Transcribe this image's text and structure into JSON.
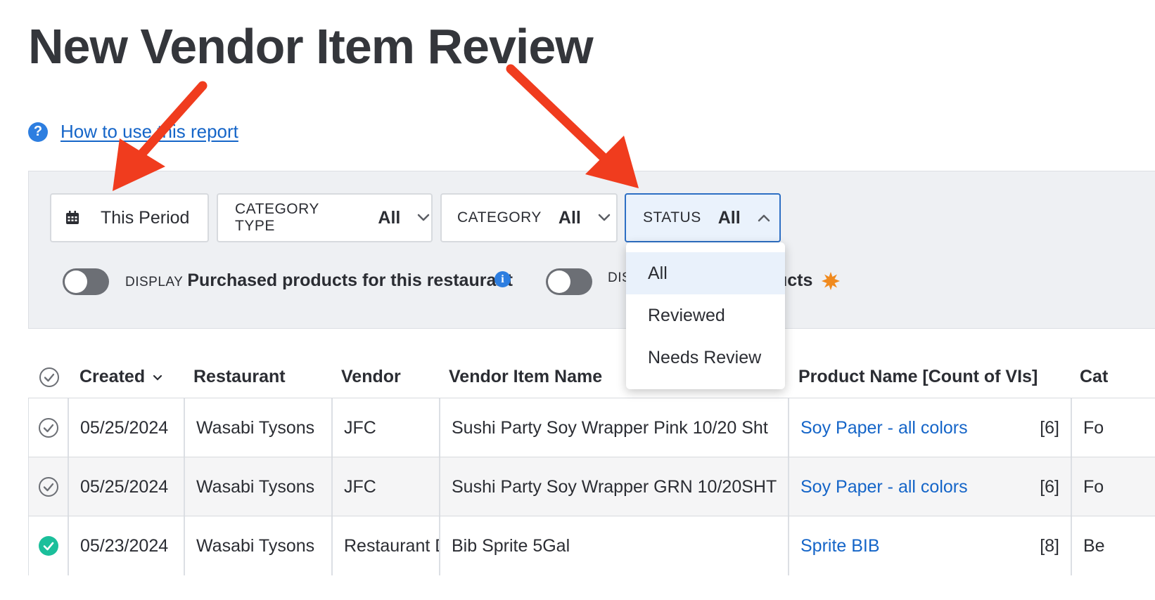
{
  "page": {
    "title": "New Vendor Item Review",
    "help_link": "How to use this report"
  },
  "filters": {
    "period": "This Period",
    "category_type": {
      "label": "CATEGORY TYPE",
      "value": "All"
    },
    "category": {
      "label": "CATEGORY",
      "value": "All"
    },
    "status": {
      "label": "STATUS",
      "value": "All"
    }
  },
  "status_dropdown": {
    "options": [
      "All",
      "Reviewed",
      "Needs Review"
    ],
    "selected": "All"
  },
  "toggles": [
    {
      "small": "DISPLAY",
      "bold": "Purchased products for this restaurant",
      "on": false
    },
    {
      "small": "DIS",
      "bold": "ucts",
      "on": false
    }
  ],
  "table": {
    "headers": [
      "Created",
      "Restaurant",
      "Vendor",
      "Vendor Item Name",
      "Product Name [Count of VIs]",
      "Cat"
    ],
    "rows": [
      {
        "created": "05/25/2024",
        "restaurant": "Wasabi Tysons",
        "vendor": "JFC",
        "item": "Sushi Party Soy Wrapper Pink 10/20 Sht",
        "product": "Soy Paper - all colors",
        "count": "[6]",
        "category": "Fo",
        "reviewed": false
      },
      {
        "created": "05/25/2024",
        "restaurant": "Wasabi Tysons",
        "vendor": "JFC",
        "item": "Sushi Party Soy Wrapper GRN 10/20SHT",
        "product": "Soy Paper - all colors",
        "count": "[6]",
        "category": "Fo",
        "reviewed": false
      },
      {
        "created": "05/23/2024",
        "restaurant": "Wasabi Tysons",
        "vendor": "Restaurant D",
        "item": "Bib Sprite 5Gal",
        "product": "Sprite BIB",
        "count": "[8]",
        "category": "Be",
        "reviewed": true
      }
    ]
  },
  "colors": {
    "link": "#1565c8",
    "accent": "#2d7ee0",
    "reviewed": "#1bbf9b",
    "annotation_arrow": "#f03c1e",
    "new_badge": "#f08a1e"
  }
}
